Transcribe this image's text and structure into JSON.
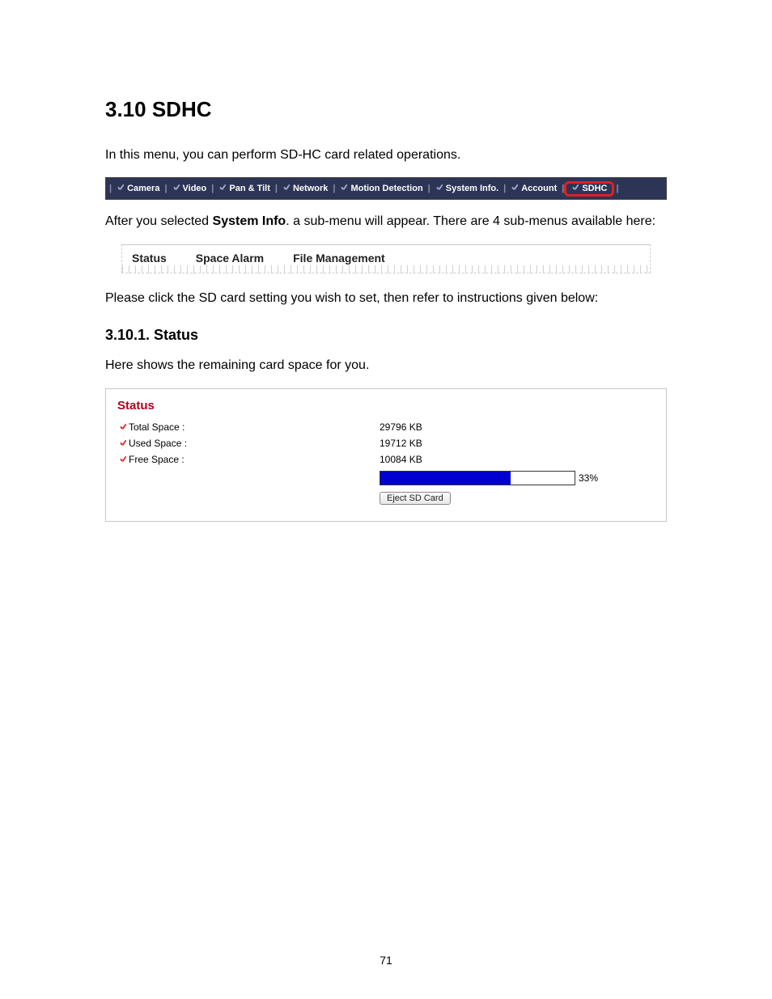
{
  "heading": "3.10 SDHC",
  "intro": "In this menu, you can perform SD-HC card related operations.",
  "navbar": {
    "items": [
      "Camera",
      "Video",
      "Pan & Tilt",
      "Network",
      "Motion Detection",
      "System Info.",
      "Account",
      "SDHC"
    ],
    "highlight_index": 7
  },
  "after_nav_pre": "After you selected ",
  "after_nav_bold": "System Info",
  "after_nav_post": ". a sub-menu will appear. There are 4 sub-menus available here:",
  "submenu": {
    "items": [
      "Status",
      "Space Alarm",
      "File Management"
    ]
  },
  "instruction": "Please click the SD card setting you wish to set, then refer to instructions given below:",
  "subsection": "3.10.1.  Status",
  "subsection_body": "Here shows the remaining card space for you.",
  "status_panel": {
    "title": "Status",
    "rows": [
      {
        "label": "Total Space :",
        "value": "29796 KB"
      },
      {
        "label": "Used Space :",
        "value": "19712 KB"
      },
      {
        "label": "Free Space :",
        "value": "10084 KB"
      }
    ],
    "progress_percent": 33,
    "progress_label": "33%",
    "eject_button": "Eject SD Card"
  },
  "page_number": "71"
}
